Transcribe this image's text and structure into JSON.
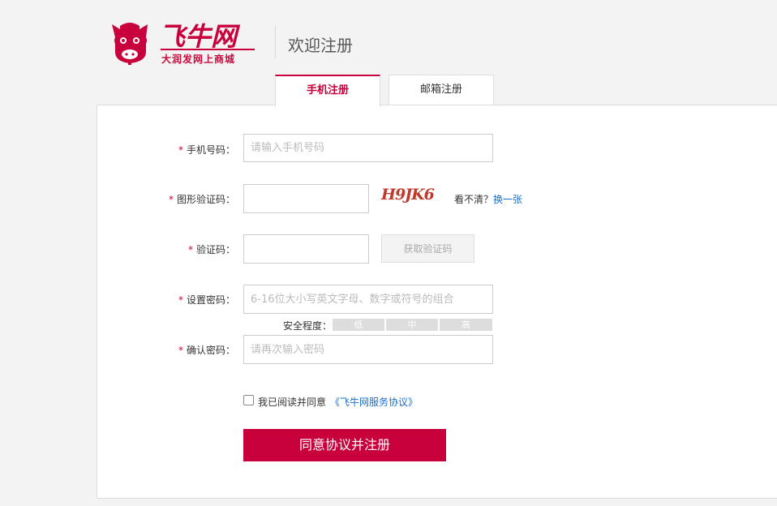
{
  "brand": {
    "logo_text": "飞牛网",
    "tagline": "大润发网上商城",
    "accent": "#c8003c"
  },
  "header": {
    "title": "欢迎注册"
  },
  "tabs": [
    {
      "label": "手机注册",
      "active": true
    },
    {
      "label": "邮箱注册",
      "active": false
    }
  ],
  "form": {
    "phone": {
      "label": "手机号码：",
      "placeholder": "请输入手机号码"
    },
    "captcha": {
      "label": "图形验证码：",
      "placeholder": "",
      "image_text": "H9JK6",
      "unclear": "看不清？",
      "refresh": "换一张"
    },
    "sms": {
      "label": "验证码：",
      "placeholder": "",
      "button": "获取验证码"
    },
    "password": {
      "label": "设置密码：",
      "placeholder": "6-16位大小写英文字母、数字或符号的组合"
    },
    "strength": {
      "label": "安全程度：",
      "levels": [
        "低",
        "中",
        "高"
      ]
    },
    "confirm": {
      "label": "确认密码：",
      "placeholder": "请再次输入密码"
    },
    "agree": {
      "text": "我已阅读并同意",
      "link": "《飞牛网服务协议》",
      "checked": false
    },
    "submit": "同意协议并注册"
  }
}
